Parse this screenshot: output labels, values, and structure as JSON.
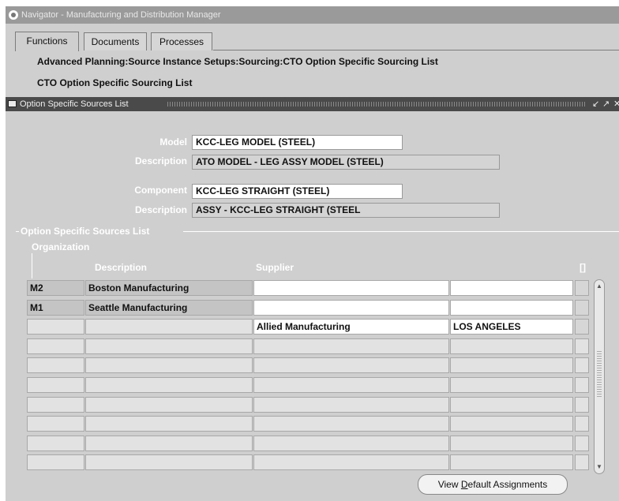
{
  "window": {
    "title": "Navigator - Manufacturing and Distribution Manager"
  },
  "tabs": [
    {
      "label": "Functions",
      "active": true
    },
    {
      "label": "Documents",
      "active": false
    },
    {
      "label": "Processes",
      "active": false
    }
  ],
  "breadcrumb": "Advanced  Planning:Source Instance Setups:Sourcing:CTO Option Specific Sourcing List",
  "page_title": "CTO Option Specific Sourcing List",
  "form": {
    "title": "Option Specific Sources List",
    "controls": [
      "↙",
      "↗",
      "✕"
    ],
    "model_label": "Model",
    "model_value": "KCC-LEG MODEL (STEEL)",
    "model_desc_label": "Description",
    "model_desc_value": "ATO MODEL - LEG ASSY MODEL (STEEL)",
    "component_label": "Component",
    "component_value": "KCC-LEG STRAIGHT (STEEL)",
    "component_desc_label": "Description",
    "component_desc_value": "ASSY - KCC-LEG STRAIGHT (STEEL"
  },
  "sources": {
    "section_title": "Option Specific Sources List",
    "org_label": "Organization",
    "columns": {
      "description": "Description",
      "supplier": "Supplier",
      "flex": "[]"
    },
    "rows": [
      {
        "org": "M2",
        "description": "Boston Manufacturing",
        "supplier": "",
        "site": ""
      },
      {
        "org": "M1",
        "description": "Seattle Manufacturing",
        "supplier": "",
        "site": ""
      },
      {
        "org": "",
        "description": "",
        "supplier": "Allied Manufacturing",
        "site": "LOS ANGELES"
      },
      {
        "org": "",
        "description": "",
        "supplier": "",
        "site": ""
      },
      {
        "org": "",
        "description": "",
        "supplier": "",
        "site": ""
      },
      {
        "org": "",
        "description": "",
        "supplier": "",
        "site": ""
      },
      {
        "org": "",
        "description": "",
        "supplier": "",
        "site": ""
      },
      {
        "org": "",
        "description": "",
        "supplier": "",
        "site": ""
      },
      {
        "org": "",
        "description": "",
        "supplier": "",
        "site": ""
      },
      {
        "org": "",
        "description": "",
        "supplier": "",
        "site": ""
      }
    ]
  },
  "buttons": {
    "view_default_pre": "View ",
    "view_default_mnemonic": "D",
    "view_default_post": "efault Assignments"
  },
  "scrollbar": {
    "up_icon": "▲",
    "down_icon": "▼"
  }
}
